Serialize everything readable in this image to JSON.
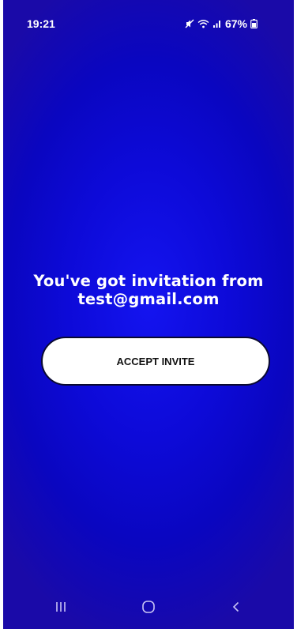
{
  "status_bar": {
    "time": "19:21",
    "battery_percent": "67%",
    "icons": [
      "mute-icon",
      "wifi-icon",
      "signal-icon",
      "battery-icon"
    ]
  },
  "invitation": {
    "title_line1": "You've got invitation from",
    "title_line2": "test@gmail.com"
  },
  "actions": {
    "accept_label": "ACCEPT INVITE"
  },
  "nav_bar": {
    "icons": [
      "recent-apps-icon",
      "home-icon",
      "back-icon"
    ]
  },
  "colors": {
    "background_primary": "#0d0ad8",
    "background_edge": "#1a0aa8",
    "button_background": "#ffffff",
    "button_text": "#111111",
    "text": "#ffffff"
  }
}
